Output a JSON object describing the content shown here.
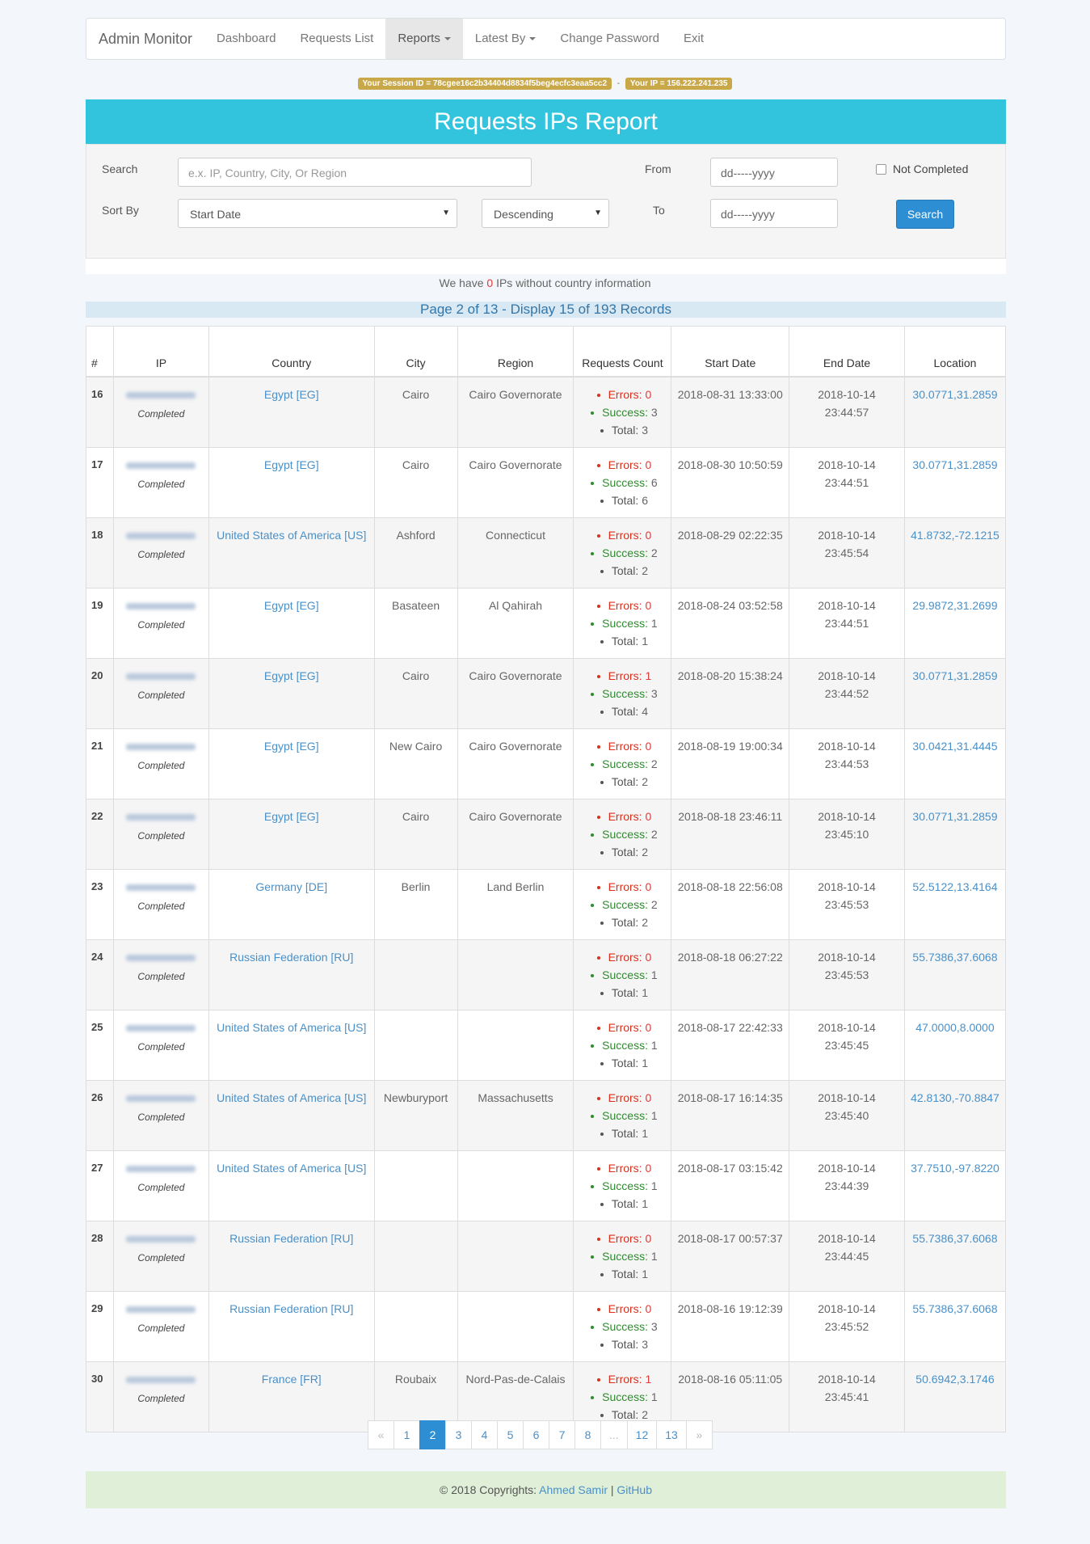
{
  "navbar": {
    "brand": "Admin Monitor",
    "items": [
      "Dashboard",
      "Requests List",
      "Reports",
      "Latest By",
      "Change Password",
      "Exit"
    ]
  },
  "session": {
    "session_label": "Your Session ID = 78cgee16c2b34404d8834f5beg4ecfc3eaa5cc2",
    "ip_label": "Your IP = 156.222.241.235",
    "separator": "-"
  },
  "report": {
    "title": "Requests IPs Report",
    "search_label": "Search",
    "search_placeholder": "e.x. IP, Country, City, Or Region",
    "from_label": "From",
    "to_label": "To",
    "date_placeholder": "dd-----yyyy",
    "not_completed_label": "Not Completed",
    "sort_label": "Sort By",
    "sort_value": "Start Date",
    "order_value": "Descending",
    "search_button": "Search"
  },
  "info": {
    "prefix": "We have ",
    "count": "0",
    "suffix": " IPs without country information"
  },
  "page_info": "Page 2 of 13 - Display 15 of 193 Records",
  "table": {
    "headers": [
      "#",
      "IP",
      "Country",
      "City",
      "Region",
      "Requests Count",
      "Start Date",
      "End Date",
      "Location"
    ],
    "status_label": "Completed",
    "errors_label": "Errors:",
    "success_label": "Success:",
    "total_label": "Total:",
    "rows": [
      {
        "n": "16",
        "country": "Egypt [EG]",
        "city": "Cairo",
        "region": "Cairo Governorate",
        "errors": "0",
        "success": "3",
        "total": "3",
        "start": "2018-08-31 13:33:00",
        "end": "2018-10-14 23:44:57",
        "loc": "30.0771,31.2859"
      },
      {
        "n": "17",
        "country": "Egypt [EG]",
        "city": "Cairo",
        "region": "Cairo Governorate",
        "errors": "0",
        "success": "6",
        "total": "6",
        "start": "2018-08-30 10:50:59",
        "end": "2018-10-14 23:44:51",
        "loc": "30.0771,31.2859"
      },
      {
        "n": "18",
        "country": "United States of America [US]",
        "city": "Ashford",
        "region": "Connecticut",
        "errors": "0",
        "success": "2",
        "total": "2",
        "start": "2018-08-29 02:22:35",
        "end": "2018-10-14 23:45:54",
        "loc": "41.8732,-72.1215"
      },
      {
        "n": "19",
        "country": "Egypt [EG]",
        "city": "Basateen",
        "region": "Al Qahirah",
        "errors": "0",
        "success": "1",
        "total": "1",
        "start": "2018-08-24 03:52:58",
        "end": "2018-10-14 23:44:51",
        "loc": "29.9872,31.2699"
      },
      {
        "n": "20",
        "country": "Egypt [EG]",
        "city": "Cairo",
        "region": "Cairo Governorate",
        "errors": "1",
        "success": "3",
        "total": "4",
        "start": "2018-08-20 15:38:24",
        "end": "2018-10-14 23:44:52",
        "loc": "30.0771,31.2859"
      },
      {
        "n": "21",
        "country": "Egypt [EG]",
        "city": "New Cairo",
        "region": "Cairo Governorate",
        "errors": "0",
        "success": "2",
        "total": "2",
        "start": "2018-08-19 19:00:34",
        "end": "2018-10-14 23:44:53",
        "loc": "30.0421,31.4445"
      },
      {
        "n": "22",
        "country": "Egypt [EG]",
        "city": "Cairo",
        "region": "Cairo Governorate",
        "errors": "0",
        "success": "2",
        "total": "2",
        "start": "2018-08-18 23:46:11",
        "end": "2018-10-14 23:45:10",
        "loc": "30.0771,31.2859"
      },
      {
        "n": "23",
        "country": "Germany [DE]",
        "city": "Berlin",
        "region": "Land Berlin",
        "errors": "0",
        "success": "2",
        "total": "2",
        "start": "2018-08-18 22:56:08",
        "end": "2018-10-14 23:45:53",
        "loc": "52.5122,13.4164"
      },
      {
        "n": "24",
        "country": "Russian Federation [RU]",
        "city": "",
        "region": "",
        "errors": "0",
        "success": "1",
        "total": "1",
        "start": "2018-08-18 06:27:22",
        "end": "2018-10-14 23:45:53",
        "loc": "55.7386,37.6068"
      },
      {
        "n": "25",
        "country": "United States of America [US]",
        "city": "",
        "region": "",
        "errors": "0",
        "success": "1",
        "total": "1",
        "start": "2018-08-17 22:42:33",
        "end": "2018-10-14 23:45:45",
        "loc": "47.0000,8.0000"
      },
      {
        "n": "26",
        "country": "United States of America [US]",
        "city": "Newburyport",
        "region": "Massachusetts",
        "errors": "0",
        "success": "1",
        "total": "1",
        "start": "2018-08-17 16:14:35",
        "end": "2018-10-14 23:45:40",
        "loc": "42.8130,-70.8847"
      },
      {
        "n": "27",
        "country": "United States of America [US]",
        "city": "",
        "region": "",
        "errors": "0",
        "success": "1",
        "total": "1",
        "start": "2018-08-17 03:15:42",
        "end": "2018-10-14 23:44:39",
        "loc": "37.7510,-97.8220"
      },
      {
        "n": "28",
        "country": "Russian Federation [RU]",
        "city": "",
        "region": "",
        "errors": "0",
        "success": "1",
        "total": "1",
        "start": "2018-08-17 00:57:37",
        "end": "2018-10-14 23:44:45",
        "loc": "55.7386,37.6068"
      },
      {
        "n": "29",
        "country": "Russian Federation [RU]",
        "city": "",
        "region": "",
        "errors": "0",
        "success": "3",
        "total": "3",
        "start": "2018-08-16 19:12:39",
        "end": "2018-10-14 23:45:52",
        "loc": "55.7386,37.6068"
      },
      {
        "n": "30",
        "country": "France [FR]",
        "city": "Roubaix",
        "region": "Nord-Pas-de-Calais",
        "errors": "1",
        "success": "1",
        "total": "2",
        "start": "2018-08-16 05:11:05",
        "end": "2018-10-14 23:45:41",
        "loc": "50.6942,3.1746"
      }
    ]
  },
  "pagination": [
    "«",
    "1",
    "2",
    "3",
    "4",
    "5",
    "6",
    "7",
    "8",
    "...",
    "12",
    "13",
    "»"
  ],
  "pagination_active": "2",
  "footer": {
    "text": "© 2018 Copyrights: ",
    "author": "Ahmed Samir",
    "divider": " | ",
    "link": "GitHub"
  },
  "colors": {
    "header": "#33c4dd",
    "primary": "#2d8ed3",
    "gold": "#c9a84a",
    "footer": "#dfefd8",
    "error": "#d9301c",
    "success": "#2e8b2e"
  }
}
